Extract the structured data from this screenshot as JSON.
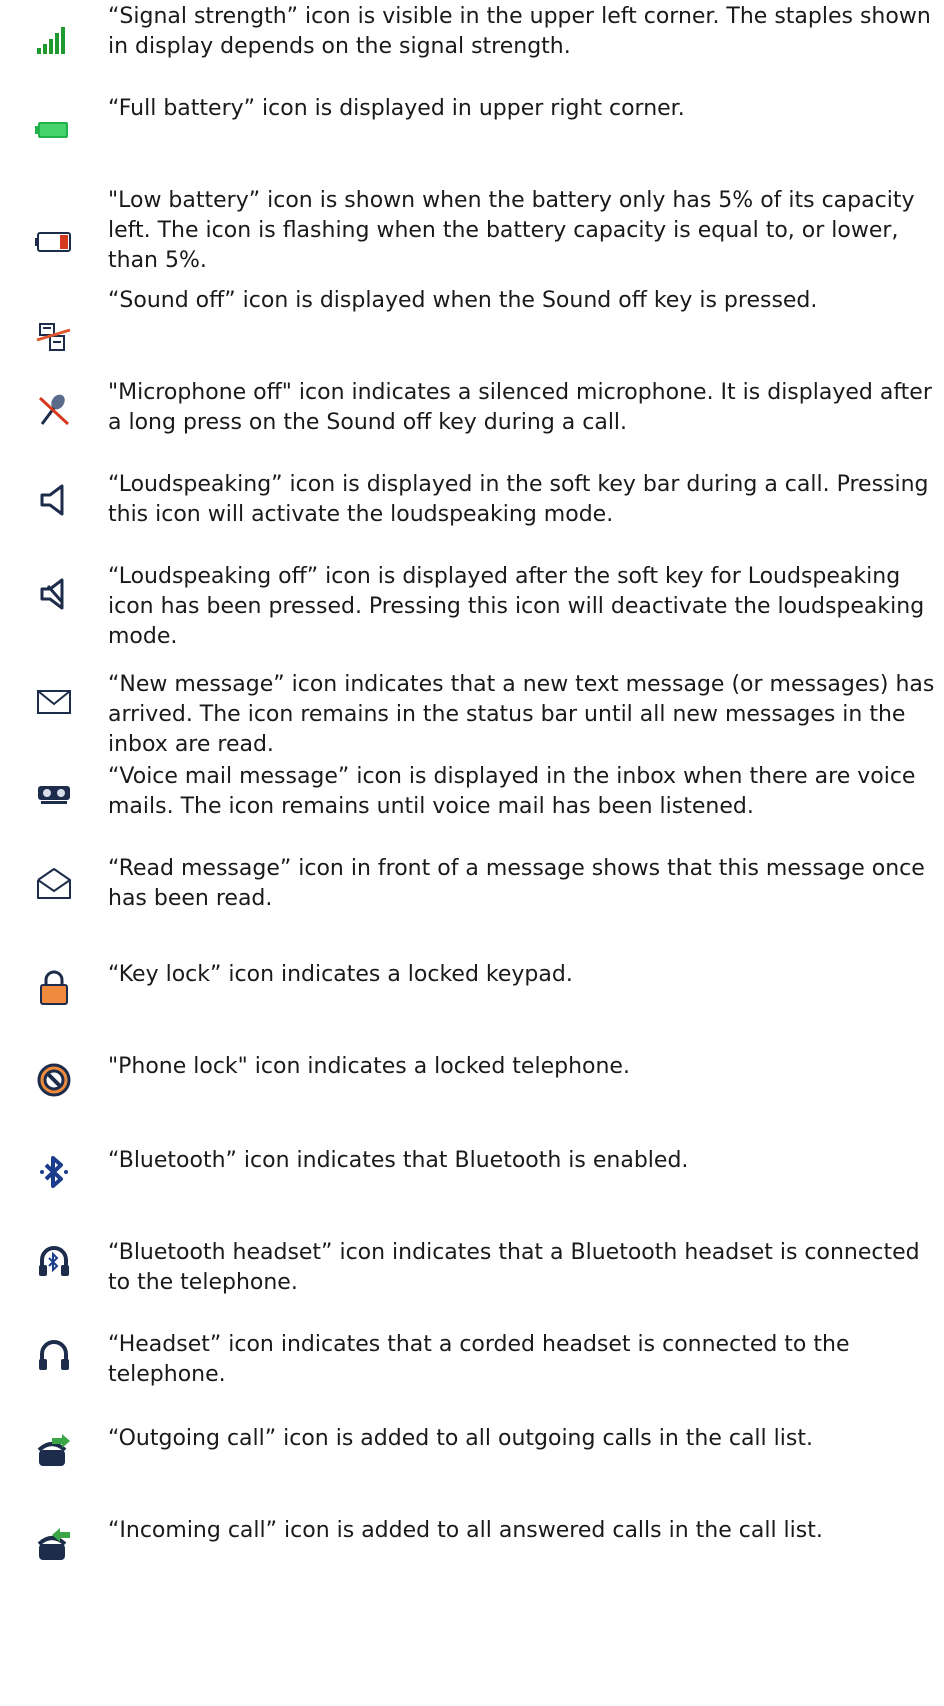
{
  "items": [
    {
      "icon": "signal-strength-icon",
      "text": "“Signal strength” icon is visible in the upper left corner. The staples shown in display depends on the signal strength."
    },
    {
      "icon": "full-battery-icon",
      "text": "“Full battery” icon is displayed in upper right corner."
    },
    {
      "icon": "low-battery-icon",
      "text": "\"Low battery” icon is shown when the battery only has 5% of its capacity left. The icon is flashing when the battery capacity is equal to, or lower, than 5%."
    },
    {
      "icon": "sound-off-icon",
      "text": "“Sound off” icon is displayed when the Sound off key is pressed."
    },
    {
      "icon": "microphone-off-icon",
      "text": "\"Microphone off\" icon indicates a silenced microphone. It is displayed after a long press on the Sound off key during a call."
    },
    {
      "icon": "loudspeaking-icon",
      "text": "“Loudspeaking” icon is displayed in the soft key bar during a call. Pressing this icon will activate the loudspeaking mode."
    },
    {
      "icon": "loudspeaking-off-icon",
      "text": "“Loudspeaking off” icon is displayed after the soft key for Loudspeaking icon has been pressed. Pressing this icon will deactivate the loudspeaking mode."
    },
    {
      "icon": "new-message-icon",
      "text": "“New message” icon indicates that a new text message (or messages) has arrived. The icon remains in the status bar until all new messages in the inbox are read."
    },
    {
      "icon": "voice-mail-icon",
      "text": "“Voice mail message” icon is displayed in the inbox when there are voice mails. The icon remains until voice mail has been listened."
    },
    {
      "icon": "read-message-icon",
      "text": "“Read message” icon in front of a message shows that this message once has been read."
    },
    {
      "icon": "key-lock-icon",
      "text": "“Key lock” icon indicates a locked keypad."
    },
    {
      "icon": "phone-lock-icon",
      "text": "\"Phone lock\" icon indicates a locked telephone."
    },
    {
      "icon": "bluetooth-icon",
      "text": "“Bluetooth” icon indicates that Bluetooth is enabled."
    },
    {
      "icon": "bluetooth-headset-icon",
      "text": "“Bluetooth headset” icon indicates that a Bluetooth headset is connected to the telephone."
    },
    {
      "icon": "headset-icon",
      "text": "“Headset” icon indicates that a corded headset is connected to the telephone."
    },
    {
      "icon": "outgoing-call-icon",
      "text": "“Outgoing call” icon is added to all outgoing calls in the call list."
    },
    {
      "icon": "incoming-call-icon",
      "text": "“Incoming call” icon is added to all answered calls in the call list."
    }
  ],
  "colors": {
    "signal_green": "#1e9a2f",
    "battery_green": "#22b24c",
    "battery_red": "#d63a1e",
    "lock_orange": "#f08a3c",
    "bluetooth_blue": "#1c3d8c",
    "call_green": "#3aa648",
    "icon_dark": "#1c2c4a"
  }
}
